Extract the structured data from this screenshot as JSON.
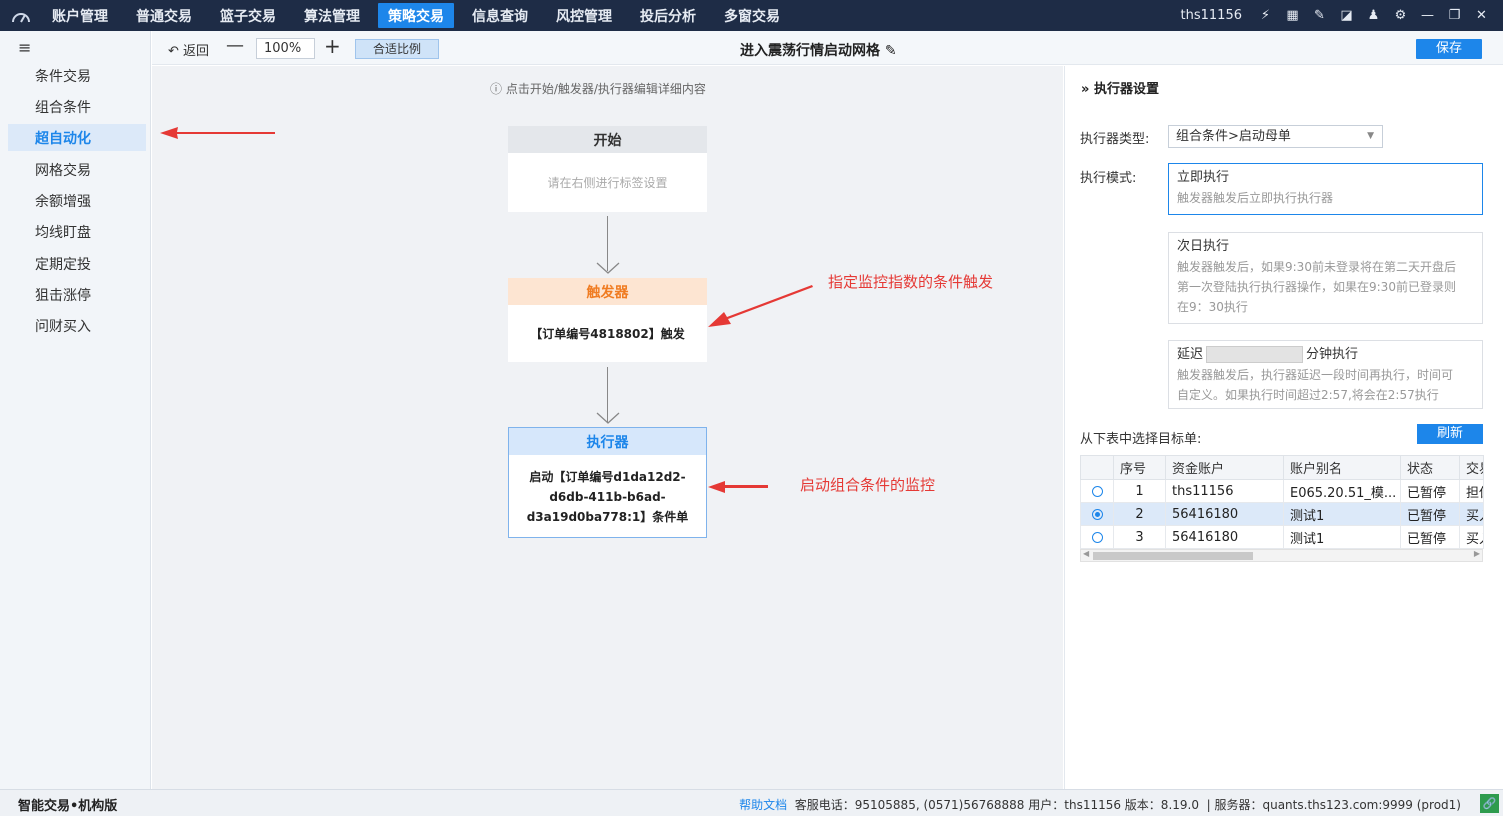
{
  "topbar": {
    "nav": [
      "账户管理",
      "普通交易",
      "篮子交易",
      "算法管理",
      "策略交易",
      "信息查询",
      "风控管理",
      "投后分析",
      "多窗交易"
    ],
    "active_index": 4,
    "user": "ths11156"
  },
  "sidebar": {
    "items": [
      "条件交易",
      "组合条件",
      "超自动化",
      "网格交易",
      "余额增强",
      "均线盯盘",
      "定期定投",
      "狙击涨停",
      "问财买入"
    ],
    "active_index": 2
  },
  "toolbar": {
    "back_label": "返回",
    "zoom_value": "100%",
    "fit_label": "合适比例",
    "title": "进入震荡行情启动网格",
    "save_label": "保存"
  },
  "canvas": {
    "hint": "点击开始/触发器/执行器编辑详细内容",
    "start": {
      "title": "开始",
      "body": "请在右侧进行标签设置"
    },
    "trigger": {
      "title": "触发器",
      "body": "【订单编号4818802】触发"
    },
    "executor": {
      "title": "执行器",
      "body_line1": "启动【订单编号d1da12d2-",
      "body_line2": "d6db-411b-b6ad-",
      "body_line3": "d3a19d0ba778:1】条件单"
    }
  },
  "annotations": {
    "trigger_note": "指定监控指数的条件触发",
    "executor_note": "启动组合条件的监控"
  },
  "right_panel": {
    "title": "执行器设置",
    "type_label": "执行器类型:",
    "type_value": "组合条件>启动母单",
    "mode_label": "执行模式:",
    "modes": [
      {
        "title": "立即执行",
        "desc": "触发器触发后立即执行执行器"
      },
      {
        "title": "次日执行",
        "desc_1": "触发器触发后，如果9:30前未登录将在第二天开盘后",
        "desc_2": "第一次登陆执行执行器操作，如果在9:30前已登录则",
        "desc_3": "在9：30执行"
      },
      {
        "title_pre": "延迟",
        "title_post": "分钟执行",
        "desc_1": "触发器触发后，执行器延迟一段时间再执行，时间可",
        "desc_2": "自定义。如果执行时间超过2:57,将会在2:57执行"
      }
    ],
    "select_label": "从下表中选择目标单:",
    "refresh_label": "刷新",
    "table": {
      "headers": [
        "",
        "序号",
        "资金账户",
        "账户别名",
        "状态",
        "交易"
      ],
      "rows": [
        {
          "selected": false,
          "no": "1",
          "account": "ths11156",
          "alias": "E065.20.51_模...",
          "status": "已暂停",
          "trade": "担保"
        },
        {
          "selected": true,
          "no": "2",
          "account": "56416180",
          "alias": "测试1",
          "status": "已暂停",
          "trade": "买入"
        },
        {
          "selected": false,
          "no": "3",
          "account": "56416180",
          "alias": "测试1",
          "status": "已暂停",
          "trade": "买入"
        }
      ]
    }
  },
  "statusbar": {
    "app_name": "智能交易•机构版",
    "help_link": "帮助文档",
    "info": "客服电话：95105885, (0571)56768888  用户：ths11156  版本：8.19.0",
    "server": "服务器：quants.ths123.com:9999  (prod1)"
  },
  "colors": {
    "topbar": "#1e2c46",
    "accent": "#1d86ea",
    "annotation": "#e53935",
    "trigger_head": "#fde5d2",
    "executor_head": "#d6e7fb"
  }
}
